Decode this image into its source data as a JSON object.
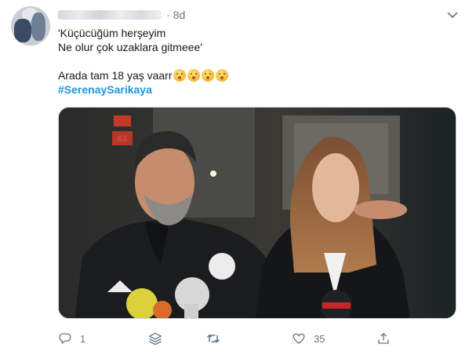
{
  "tweet": {
    "time": "8d",
    "separator": "·",
    "text_lines": [
      "'Küçücüğüm herşeyim",
      "Ne olur çok uzaklara gitmeee'"
    ],
    "line3": "Arada tam 18 yaş vaarr",
    "emojis": [
      "hushed-face-emoji",
      "hushed-face-emoji",
      "shushing-face-emoji",
      "shushing-face-emoji"
    ],
    "hashtag": "#SerenaySarikaya",
    "sign_text": "63"
  },
  "actions": {
    "reply_count": "1",
    "like_count": "35"
  },
  "colors": {
    "hashtag": "#1b95e0",
    "muted": "#657786",
    "text": "#14171a"
  }
}
